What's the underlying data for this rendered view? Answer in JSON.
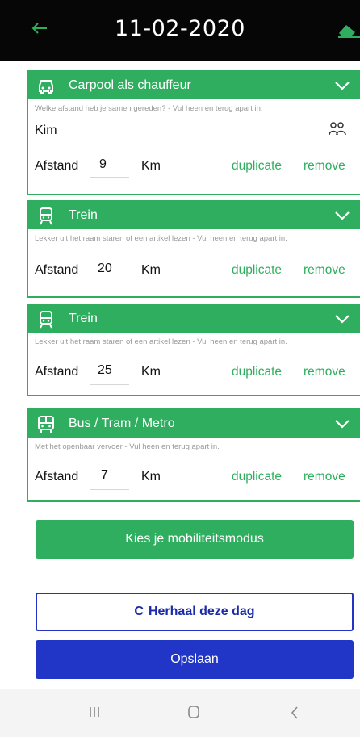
{
  "header": {
    "date": "11-02-2020",
    "back_icon": "arrow-left-icon",
    "eraser_icon": "eraser-icon"
  },
  "trips": [
    {
      "mode_icon": "car-icon",
      "title": "Carpool als chauffeur",
      "hint": "Welke afstand heb je samen gereden? - Vul heen en terug apart in.",
      "person": "Kim",
      "afstand_label": "Afstand",
      "distance": "9",
      "unit": "Km",
      "duplicate": "duplicate",
      "remove": "remove"
    },
    {
      "mode_icon": "train-icon",
      "title": "Trein",
      "hint": "Lekker uit het raam staren of een artikel lezen - Vul heen en terug apart in.",
      "afstand_label": "Afstand",
      "distance": "20",
      "unit": "Km",
      "duplicate": "duplicate",
      "remove": "remove"
    },
    {
      "mode_icon": "train-icon",
      "title": "Trein",
      "hint": "Lekker uit het raam staren of een artikel lezen - Vul heen en terug apart in.",
      "afstand_label": "Afstand",
      "distance": "25",
      "unit": "Km",
      "duplicate": "duplicate",
      "remove": "remove"
    },
    {
      "mode_icon": "bus-icon",
      "title": "Bus / Tram / Metro",
      "hint": "Met het openbaar vervoer - Vul heen en terug apart in.",
      "afstand_label": "Afstand",
      "distance": "7",
      "unit": "Km",
      "duplicate": "duplicate",
      "remove": "remove"
    }
  ],
  "buttons": {
    "choose_mode": "Kies je mobiliteitsmodus",
    "repeat_day": "Herhaal deze dag",
    "repeat_icon": "C",
    "save": "Opslaan"
  },
  "colors": {
    "accent_green": "#2fae5f",
    "primary_blue": "#2136c7",
    "header_bg": "#060606"
  }
}
